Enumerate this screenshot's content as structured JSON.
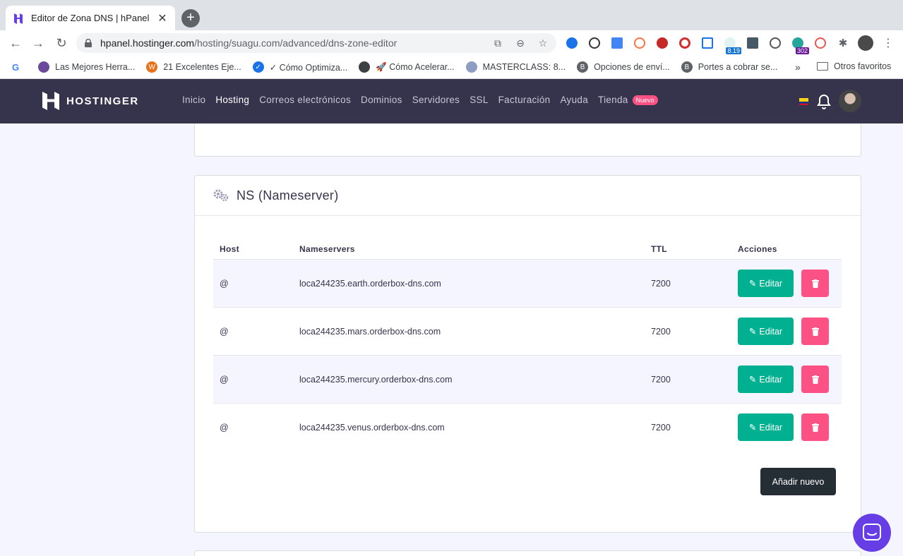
{
  "browser": {
    "tab_title": "Editor de Zona DNS | hPanel",
    "url_domain": "hpanel.hostinger.com",
    "url_path": "/hosting/suagu.com/advanced/dns-zone-editor",
    "extension_badges": {
      "ext_819": "8.19",
      "ext_302": "302"
    }
  },
  "bookmarks": {
    "items": [
      {
        "label": "",
        "color": "#4285f4",
        "icon": "google-icon"
      },
      {
        "label": "Las Mejores Herra...",
        "color": "#6b4a9b",
        "icon": "site-icon"
      },
      {
        "label": "21 Excelentes Eje...",
        "color": "#e8711a",
        "icon": "wordpress-icon"
      },
      {
        "label": "✓ Cómo Optimiza...",
        "color": "#1a73e8",
        "icon": "check-icon"
      },
      {
        "label": "🚀 Cómo Acelerar...",
        "color": "#3c4043",
        "icon": "globe-icon"
      },
      {
        "label": "MASTERCLASS: 8...",
        "color": "#8f9cc4",
        "icon": "site-icon"
      },
      {
        "label": "Opciones de enví...",
        "color": "#5f6368",
        "icon": "b-icon"
      },
      {
        "label": "Portes a cobrar se...",
        "color": "#5f6368",
        "icon": "b-icon"
      }
    ],
    "more": "»",
    "other": "Otros favoritos"
  },
  "header": {
    "brand": "HOSTINGER",
    "nav": [
      "Inicio",
      "Hosting",
      "Correos electrónicos",
      "Dominios",
      "Servidores",
      "SSL",
      "Facturación",
      "Ayuda",
      "Tienda"
    ],
    "active_nav": "Hosting",
    "new_badge": "Nuevo"
  },
  "ns_card": {
    "title": "NS (Nameserver)",
    "columns": {
      "host": "Host",
      "nameservers": "Nameservers",
      "ttl": "TTL",
      "actions": "Acciones"
    },
    "rows": [
      {
        "host": "@",
        "nameserver": "loca244235.earth.orderbox-dns.com",
        "ttl": "7200"
      },
      {
        "host": "@",
        "nameserver": "loca244235.mars.orderbox-dns.com",
        "ttl": "7200"
      },
      {
        "host": "@",
        "nameserver": "loca244235.mercury.orderbox-dns.com",
        "ttl": "7200"
      },
      {
        "host": "@",
        "nameserver": "loca244235.venus.orderbox-dns.com",
        "ttl": "7200"
      }
    ],
    "edit_label": "Editar",
    "add_label": "Añadir nuevo"
  },
  "colors": {
    "header_bg": "#36344d",
    "edit": "#00b090",
    "delete": "#fc5185",
    "chat": "#673de6"
  }
}
